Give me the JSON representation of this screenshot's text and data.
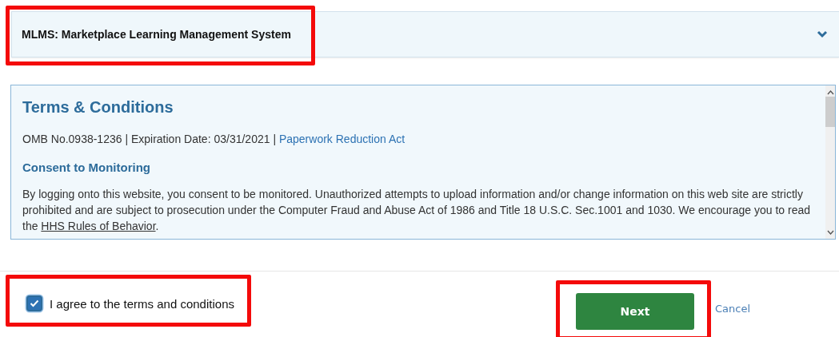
{
  "accordion": {
    "title": "MLMS: Marketplace Learning Management System",
    "expanded": false,
    "highlighted": true
  },
  "terms": {
    "heading": "Terms & Conditions",
    "meta": "OMB No.0938-1236 | Expiration Date: 03/31/2021 |",
    "meta_link": "Paperwork Reduction Act",
    "subheading": "Consent to Monitoring",
    "paragraph": {
      "before": "By logging onto this website, you consent to be monitored. Unauthorized attempts to upload information and/or change information on this web site are strictly prohibited and are subject to prosecution under the Computer Fraud and Abuse Act of 1986 and Title 18 U.S.C. Sec.1001 and 1030. We encourage you to read the",
      "link": "HHS Rules of Behavior",
      "after": "."
    }
  },
  "agreement": {
    "label": "I agree to the terms and conditions",
    "checked": true,
    "highlighted": true
  },
  "buttons": {
    "next": "Next",
    "next_highlighted": true,
    "cancel": "Cancel"
  }
}
